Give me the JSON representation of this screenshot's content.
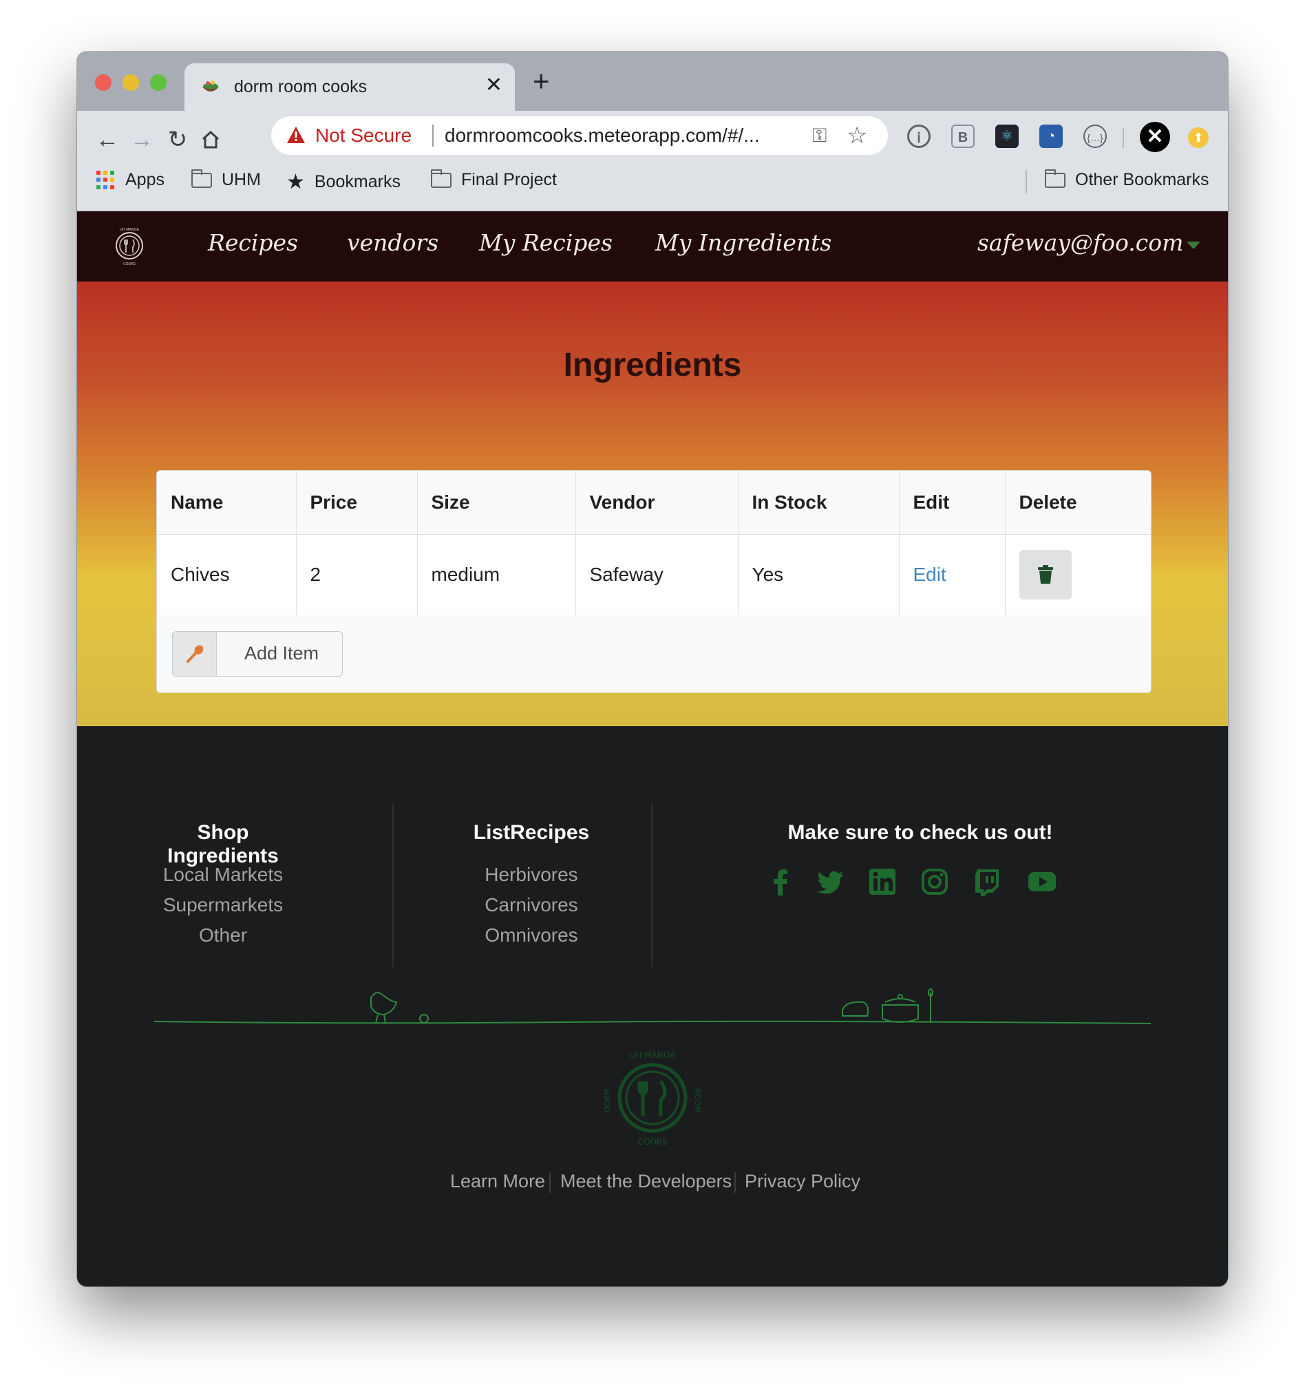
{
  "browser": {
    "tab_title": "dorm room cooks",
    "security_label": "Not Secure",
    "url": "dormroomcooks.meteorapp.com/#/...",
    "bookmarks": [
      {
        "label": "Apps",
        "icon": "apps-grid-icon"
      },
      {
        "label": "UHM",
        "icon": "folder-icon"
      },
      {
        "label": "Bookmarks",
        "icon": "star-icon"
      },
      {
        "label": "Final Project",
        "icon": "folder-icon"
      },
      {
        "label": "Other Bookmarks",
        "icon": "folder-icon"
      }
    ]
  },
  "navbar": {
    "links": [
      "Recipes",
      "vendors",
      "My Recipes",
      "My Ingredients"
    ],
    "user": "safeway@foo.com"
  },
  "main": {
    "title": "Ingredients",
    "table": {
      "headers": [
        "Name",
        "Price",
        "Size",
        "Vendor",
        "In Stock",
        "Edit",
        "Delete"
      ],
      "rows": [
        {
          "name": "Chives",
          "price": "2",
          "size": "medium",
          "vendor": "Safeway",
          "in_stock": "Yes",
          "edit": "Edit"
        }
      ]
    },
    "add_item_label": "Add Item"
  },
  "footer": {
    "col1": {
      "title": "Shop Ingredients",
      "links": [
        "Local Markets",
        "Supermarkets",
        "Other"
      ]
    },
    "col2": {
      "title": "ListRecipes",
      "links": [
        "Herbivores",
        "Carnivores",
        "Omnivores"
      ]
    },
    "col3": {
      "title": "Make sure to check us out!",
      "social": [
        "facebook-icon",
        "twitter-icon",
        "linkedin-icon",
        "instagram-icon",
        "twitch-icon",
        "youtube-icon"
      ]
    },
    "bottom_links": [
      "Learn More",
      "Meet the Developers",
      "Privacy Policy"
    ]
  },
  "colors": {
    "navbar_bg": "#210a09",
    "hero_top": "#b93122",
    "hero_bottom": "#d7bb40",
    "footer_bg": "#1b1c1e",
    "accent_green": "#2e7d32",
    "link_blue": "#4183c4"
  }
}
